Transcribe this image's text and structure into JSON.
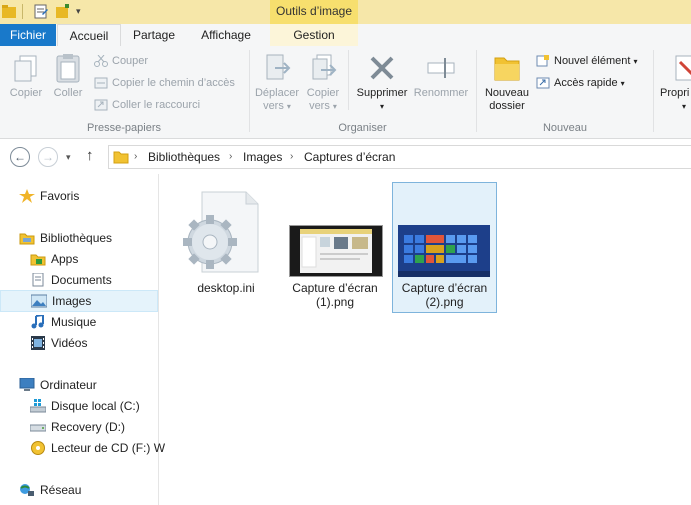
{
  "context_tab_header": "Outils d’image",
  "ribbon_tabs": [
    {
      "label": "Fichier"
    },
    {
      "label": "Accueil"
    },
    {
      "label": "Partage"
    },
    {
      "label": "Affichage"
    },
    {
      "label": "Gestion"
    }
  ],
  "ribbon": {
    "clipboard": {
      "copy": "Copier",
      "paste": "Coller",
      "cut": "Couper",
      "copy_path": "Copier le chemin d’accès",
      "paste_shortcut": "Coller le raccourci",
      "group_label": "Presse-papiers"
    },
    "organize": {
      "move_to_1": "Déplacer",
      "move_to_2": "vers",
      "copy_to_1": "Copier",
      "copy_to_2": "vers",
      "delete": "Supprimer",
      "rename": "Renommer",
      "group_label": "Organiser"
    },
    "new": {
      "new_folder_1": "Nouveau",
      "new_folder_2": "dossier",
      "new_item": "Nouvel élément",
      "easy_access": "Accès rapide",
      "group_label": "Nouveau"
    },
    "properties_partial": "Propri"
  },
  "breadcrumb": [
    "Bibliothèques",
    "Images",
    "Captures d’écran"
  ],
  "nav_pane": {
    "favorites": "Favoris",
    "libraries": "Bibliothèques",
    "library_items": [
      "Apps",
      "Documents",
      "Images",
      "Musique",
      "Vidéos"
    ],
    "computer": "Ordinateur",
    "drives": [
      "Disque local (C:)",
      "Recovery (D:)",
      "Lecteur de CD (F:) W"
    ],
    "network": "Réseau"
  },
  "files": [
    {
      "line1": "desktop.ini",
      "line2": ""
    },
    {
      "line1": "Capture d’écran",
      "line2": "(1).png"
    },
    {
      "line1": "Capture d’écran",
      "line2": "(2).png"
    }
  ],
  "colors": {
    "file_tab": "#1979ca",
    "context_tab": "#f7df6e",
    "selection": "#e5f3fb",
    "selection_border": "#7eb4dc"
  }
}
